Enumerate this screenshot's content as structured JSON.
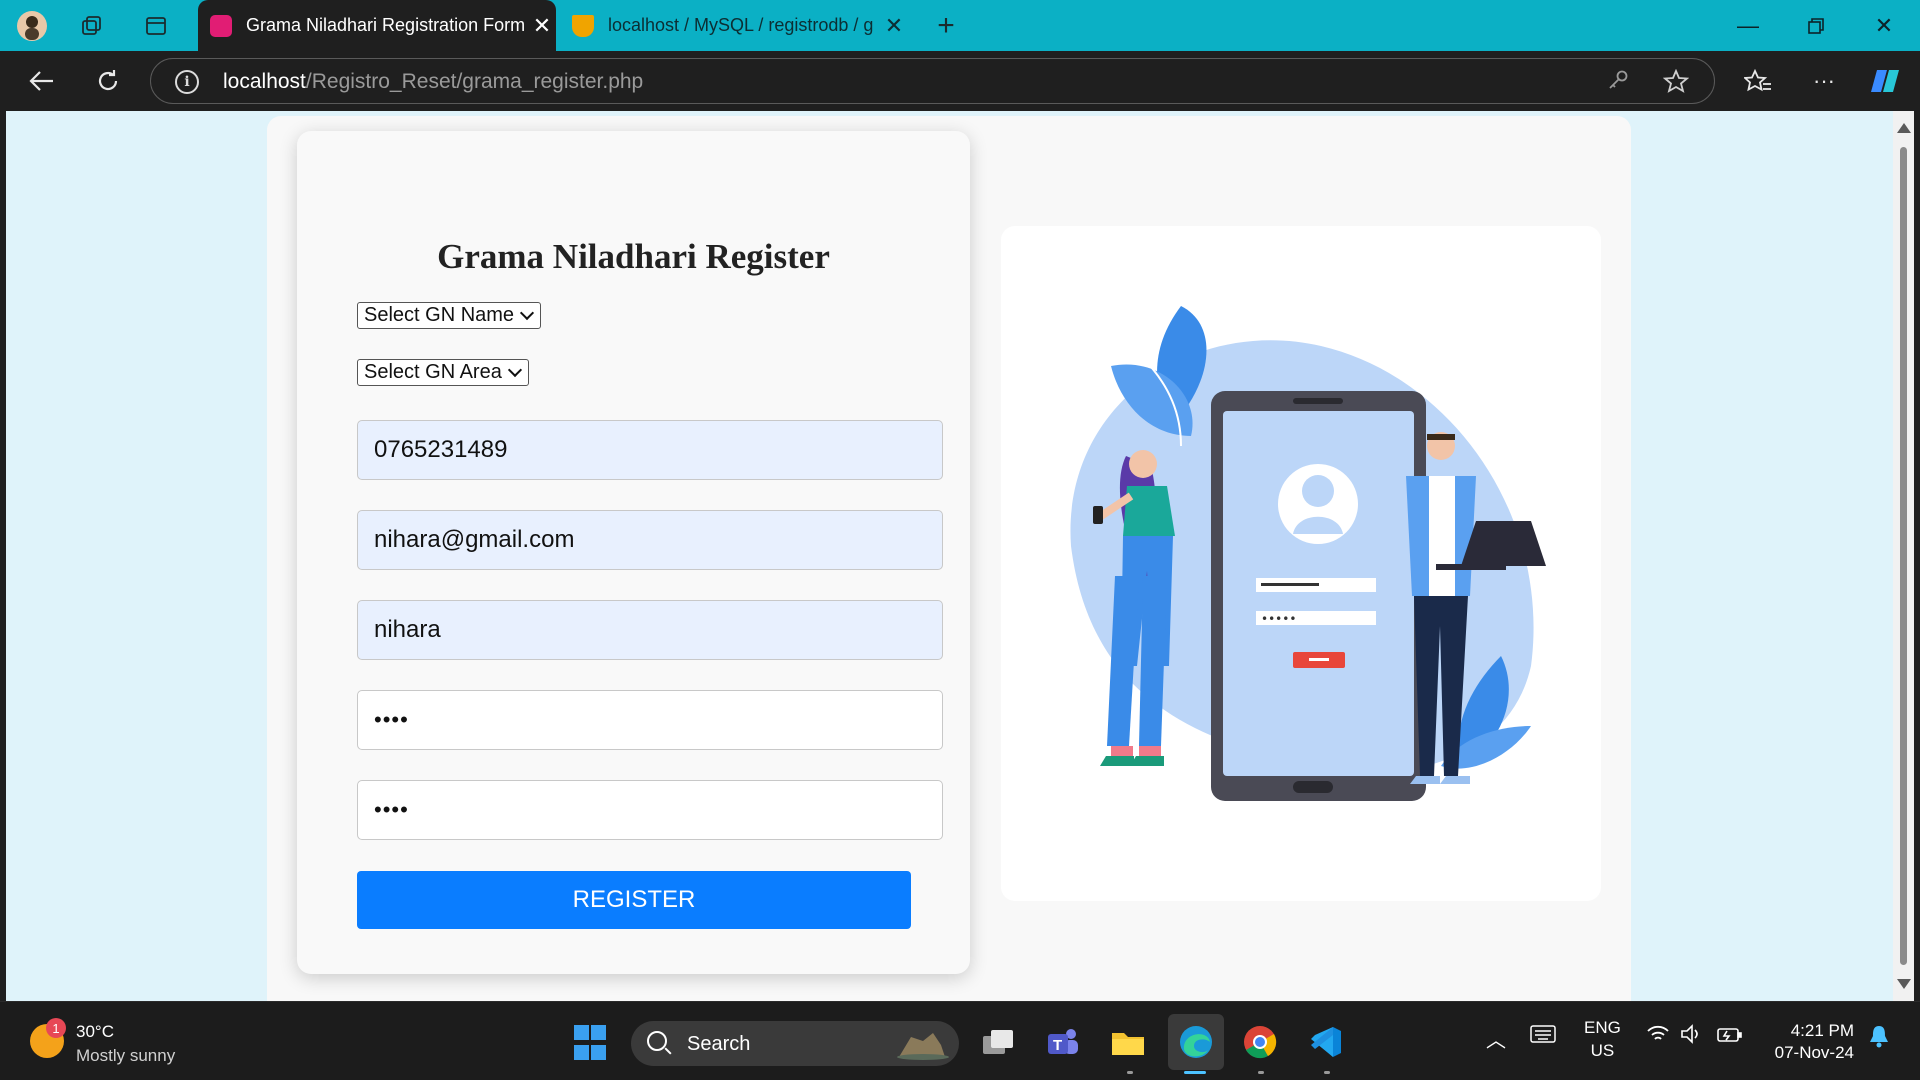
{
  "browser": {
    "tabs": [
      {
        "title": "Grama Niladhari Registration Form",
        "active": true
      },
      {
        "title": "localhost / MySQL / registrodb / g",
        "active": false
      }
    ],
    "url_host": "localhost",
    "url_path": "/Registro_Reset/grama_register.php"
  },
  "form": {
    "heading": "Grama Niladhari Register",
    "gn_name_select": "Select GN Name",
    "gn_area_select": "Select GN Area",
    "phone": "0765231489",
    "email": "nihara@gmail.com",
    "username": "nihara",
    "password": "••••",
    "confirm_password": "••••",
    "register_button": "REGISTER"
  },
  "taskbar": {
    "weather_badge": "1",
    "temperature": "30°C",
    "weather_desc": "Mostly sunny",
    "search_label": "Search",
    "lang_top": "ENG",
    "lang_bottom": "US",
    "time": "4:21 PM",
    "date": "07-Nov-24"
  },
  "colors": {
    "tabbar": "#0bb0c5",
    "page_bg": "#dff3fa",
    "accent_button": "#0a7dff",
    "autofill_bg": "#e8f0fe"
  }
}
